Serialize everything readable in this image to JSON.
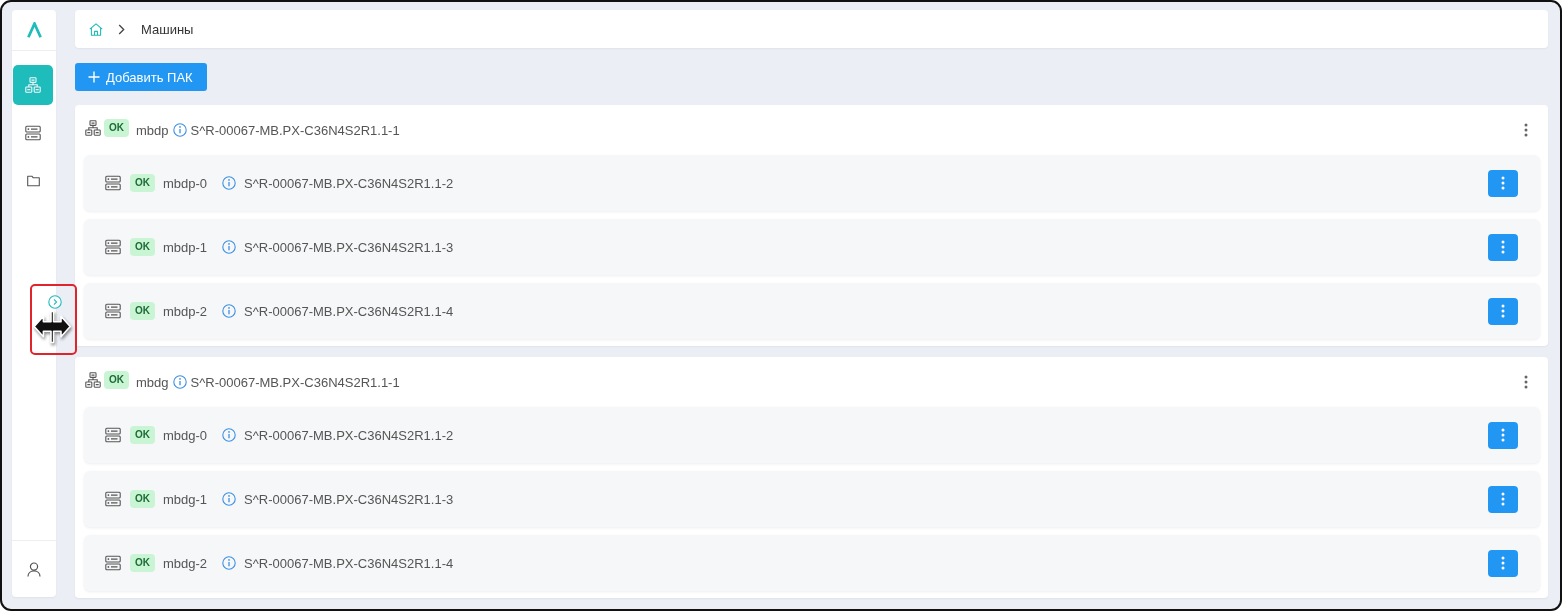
{
  "sidebar": {
    "items": [
      {
        "kind": "cluster",
        "selected": true
      },
      {
        "kind": "server",
        "selected": false
      },
      {
        "kind": "folder",
        "selected": false
      }
    ]
  },
  "breadcrumb": {
    "items": [
      {
        "label": "Машины"
      }
    ]
  },
  "add_button": {
    "label": "Добавить ПАК"
  },
  "groups": [
    {
      "name": "mbdp",
      "status": "OK",
      "serial": "S^R-00067-MB.PX-C36N4S2R1.1-1",
      "machines": [
        {
          "name": "mbdp-0",
          "status": "OK",
          "serial": "S^R-00067-MB.PX-C36N4S2R1.1-2"
        },
        {
          "name": "mbdp-1",
          "status": "OK",
          "serial": "S^R-00067-MB.PX-C36N4S2R1.1-3"
        },
        {
          "name": "mbdp-2",
          "status": "OK",
          "serial": "S^R-00067-MB.PX-C36N4S2R1.1-4"
        }
      ]
    },
    {
      "name": "mbdg",
      "status": "OK",
      "serial": "S^R-00067-MB.PX-C36N4S2R1.1-1",
      "machines": [
        {
          "name": "mbdg-0",
          "status": "OK",
          "serial": "S^R-00067-MB.PX-C36N4S2R1.1-2"
        },
        {
          "name": "mbdg-1",
          "status": "OK",
          "serial": "S^R-00067-MB.PX-C36N4S2R1.1-3"
        },
        {
          "name": "mbdg-2",
          "status": "OK",
          "serial": "S^R-00067-MB.PX-C36N4S2R1.1-4"
        }
      ]
    }
  ]
}
